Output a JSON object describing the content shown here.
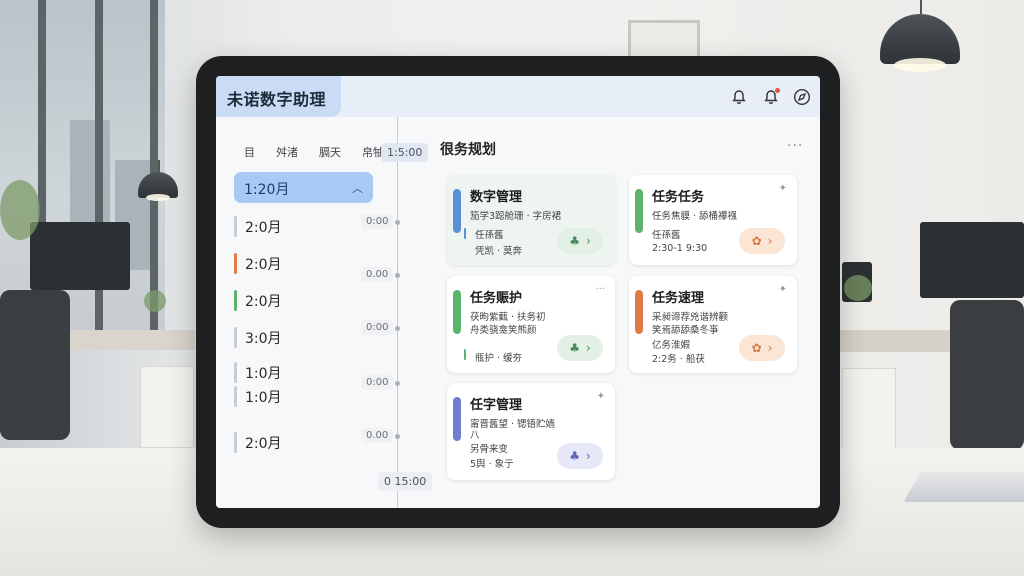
{
  "app": {
    "title": "未诺数字助理"
  },
  "header_icons": [
    "bell-icon",
    "alert-bell-icon",
    "compass-icon"
  ],
  "sidebar": {
    "tabs": [
      "目",
      "舛渚",
      "膈天",
      "帛牰"
    ],
    "selected_month": "1:20月",
    "months": [
      {
        "label": "2:0月",
        "color": "#c8cdd4"
      },
      {
        "label": "2:0月",
        "color": "#e07a4a"
      },
      {
        "label": "2:0月",
        "color": "#5cb36a"
      },
      {
        "label": "3:0月",
        "color": "#c8cdd4"
      },
      {
        "label": "1:0月",
        "color": "#c8cdd4"
      },
      {
        "label": "1:0月",
        "color": "#c8cdd4"
      },
      {
        "label": "2:0月",
        "color": "#c8cdd4"
      }
    ]
  },
  "timeline": {
    "head": "1:5:00",
    "ticks": [
      "0:00",
      "0.00",
      "0:00",
      "0:00",
      "0.00"
    ],
    "foot": "0 15:00"
  },
  "main": {
    "title": "很务规划",
    "more": "···",
    "cards": [
      {
        "title": "数字管理",
        "l1": "笳学3跽舱珊 · 字房裙",
        "l2": "任孫舊",
        "l3": "凭凯 · 莫奔",
        "l4": "",
        "stripe": "#5b8fd6",
        "thin": "#5b8fd6",
        "action": "#e2f0e6",
        "action_icon": "♣",
        "action_color": "#4a8a5c",
        "menu": ""
      },
      {
        "title": "任务任务",
        "l1": "任务焦貘 · 舔桶襻襁",
        "l2": "任孫舊",
        "l3": "2:30-1 9:30",
        "l4": "",
        "stripe": "#5cb36a",
        "thin": "",
        "action": "#fbe6d6",
        "action_icon": "✿",
        "action_color": "#d7793f",
        "menu": "✦"
      },
      {
        "title": "任务赈护",
        "l1": "茯昫紫薽 · 扶务初",
        "l2": "舟类骁龛笑熊颜",
        "l3": "瓶护 · 缓夯",
        "l4": "",
        "stripe": "#5cb36a",
        "thin": "#5cb36a",
        "action": "#e2f0e6",
        "action_icon": "♣",
        "action_color": "#4a8a5c",
        "menu": "···"
      },
      {
        "title": "任务速理",
        "l1": "采昶谛荐兇谐辨颧",
        "l2": "笑焉舔舔桑冬亊",
        "l3": "亿务淮婽",
        "l4": "2:2务 · 船茯",
        "stripe": "#e07a4a",
        "thin": "",
        "action": "#fbe6d6",
        "action_icon": "✿",
        "action_color": "#d7793f",
        "menu": "✦"
      },
      {
        "title": "任字管理",
        "l1": "甯晋舊望 · 锶铻贮嫱",
        "l2": "八",
        "l3": "另骨来变",
        "l4": "5舆 · 象亍",
        "stripe": "#6f7ed0",
        "thin": "",
        "action": "#e6e8f7",
        "action_icon": "♣",
        "action_color": "#5a66b8",
        "menu": "✦"
      }
    ]
  }
}
